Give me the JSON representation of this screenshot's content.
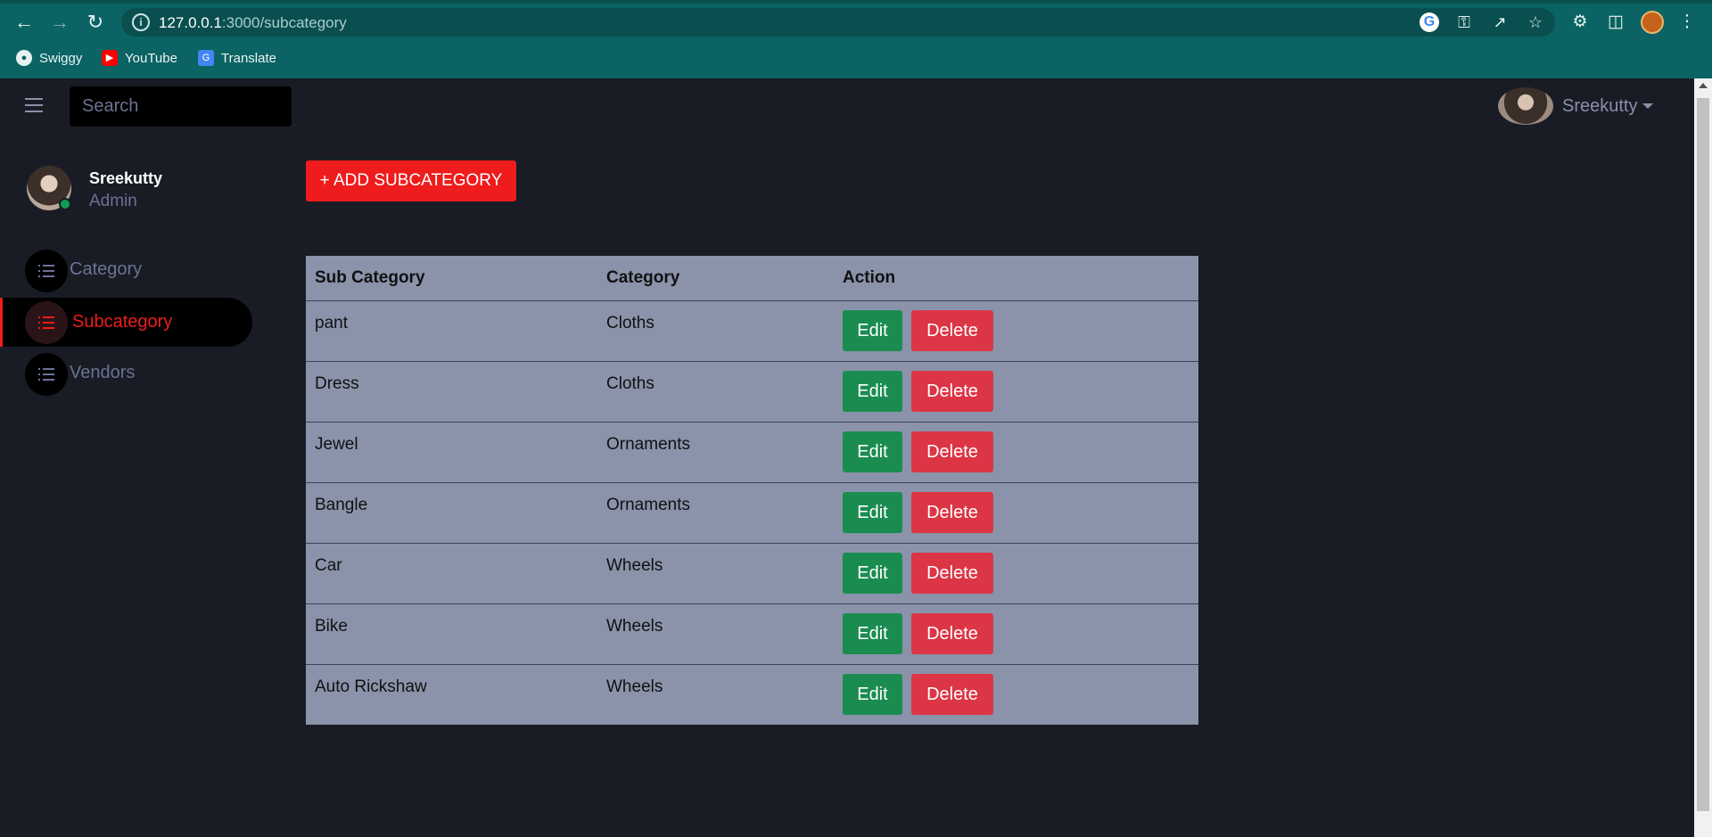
{
  "browser": {
    "url_host": "127.0.0.1",
    "url_path": ":3000/subcategory",
    "bookmarks": [
      {
        "label": "Swiggy",
        "icon": "globe-icon"
      },
      {
        "label": "YouTube",
        "icon": "youtube-icon"
      },
      {
        "label": "Translate",
        "icon": "translate-icon"
      }
    ]
  },
  "topbar": {
    "search_placeholder": "Search",
    "user_name": "Sreekutty"
  },
  "sidebar": {
    "profile_name": "Sreekutty",
    "profile_role": "Admin",
    "items": [
      {
        "label": "Category",
        "active": false
      },
      {
        "label": "Subcategory",
        "active": true
      },
      {
        "label": "Vendors",
        "active": false
      }
    ]
  },
  "main": {
    "add_button_label": "+ ADD SUBCATEGORY",
    "table": {
      "headers": [
        "Sub Category",
        "Category",
        "Action"
      ],
      "rows": [
        {
          "subcategory": "pant",
          "category": "Cloths"
        },
        {
          "subcategory": "Dress",
          "category": "Cloths"
        },
        {
          "subcategory": "Jewel",
          "category": "Ornaments"
        },
        {
          "subcategory": "Bangle",
          "category": "Ornaments"
        },
        {
          "subcategory": "Car",
          "category": "Wheels"
        },
        {
          "subcategory": "Bike",
          "category": "Wheels"
        },
        {
          "subcategory": "Auto Rickshaw",
          "category": "Wheels"
        }
      ],
      "edit_label": "Edit",
      "delete_label": "Delete"
    }
  },
  "colors": {
    "accent": "#ee1c1c",
    "edit": "#1a8c50",
    "delete": "#dc3545",
    "table_bg": "#8a93aa",
    "app_bg": "#191c24",
    "chrome_bg": "#0b6363"
  }
}
